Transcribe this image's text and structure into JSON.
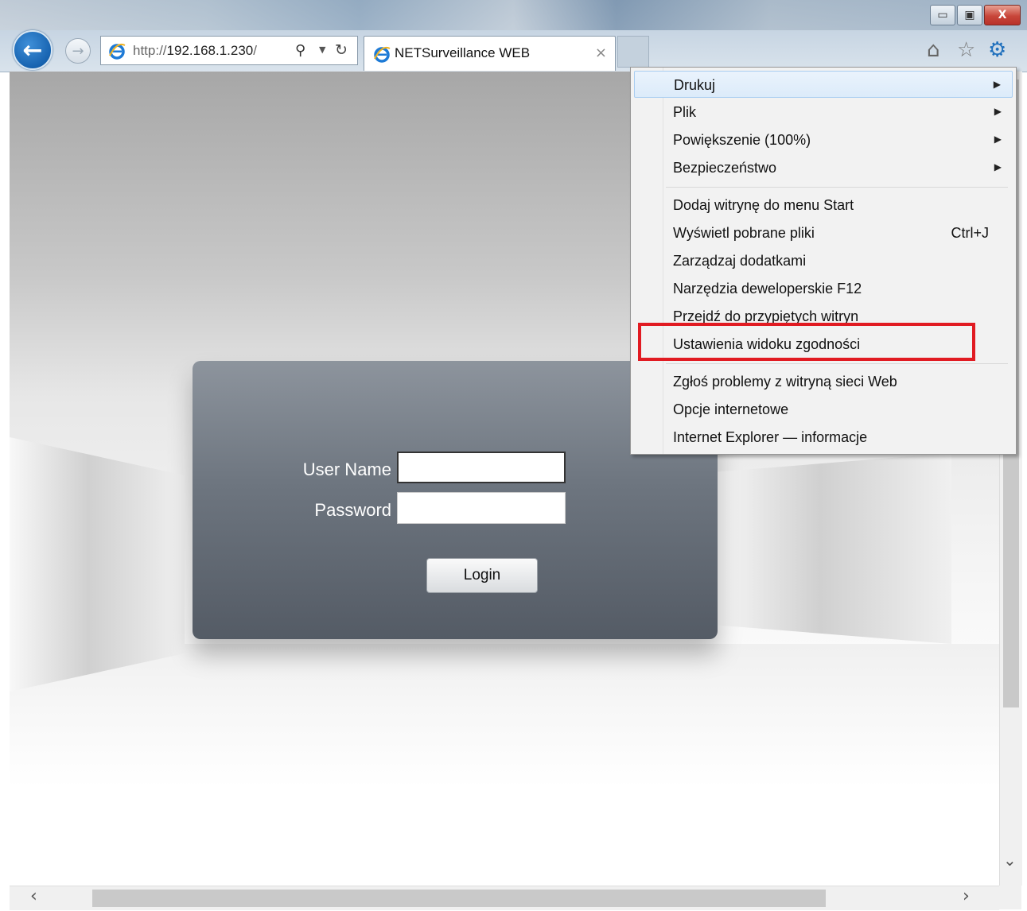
{
  "address_bar": {
    "url_prefix": "http://",
    "url_host": "192.168.1.230",
    "url_suffix": "/"
  },
  "tab": {
    "title": "NETSurveillance WEB",
    "close": "×"
  },
  "window_buttons": {
    "minimize": "▭",
    "restore": "▣",
    "close": "X"
  },
  "login": {
    "username_label": "User Name",
    "password_label": "Password",
    "login_button": "Login"
  },
  "menu": {
    "items": [
      {
        "label": "Drukuj",
        "submenu": true
      },
      {
        "label": "Plik",
        "submenu": true
      },
      {
        "label": "Powiększenie (100%)",
        "submenu": true
      },
      {
        "label": "Bezpieczeństwo",
        "submenu": true
      },
      {
        "label": "Dodaj witrynę do menu Start"
      },
      {
        "label": "Wyświetl pobrane pliki",
        "shortcut": "Ctrl+J"
      },
      {
        "label": "Zarządzaj dodatkami"
      },
      {
        "label": "Narzędzia deweloperskie F12"
      },
      {
        "label": "Przejdź do przypiętych witryn"
      },
      {
        "label": "Ustawienia widoku zgodności"
      },
      {
        "label": "Zgłoś problemy z witryną sieci Web"
      },
      {
        "label": "Opcje internetowe"
      },
      {
        "label": "Internet Explorer — informacje"
      }
    ]
  },
  "colors": {
    "highlight_box": "#e11b22",
    "accent": "#2070bd"
  }
}
